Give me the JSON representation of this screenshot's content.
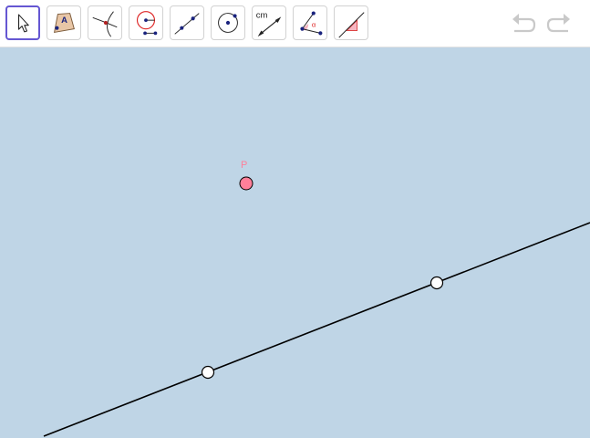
{
  "toolbar": {
    "tools": [
      {
        "icon": "move-arrow-icon",
        "active": true
      },
      {
        "icon": "polygon-icon",
        "label": "A",
        "active": false
      },
      {
        "icon": "intersect-icon",
        "active": false
      },
      {
        "icon": "circle-with-radius-icon",
        "active": false
      },
      {
        "icon": "line-through-points-icon",
        "active": false
      },
      {
        "icon": "circle-with-center-icon",
        "active": false
      },
      {
        "icon": "distance-icon",
        "label": "cm",
        "active": false
      },
      {
        "icon": "angle-icon",
        "label": "α",
        "active": false
      },
      {
        "icon": "slope-icon",
        "active": false
      }
    ],
    "undo_icon": "undo-icon",
    "redo_icon": "redo-icon"
  },
  "graphics": {
    "point_p": {
      "label": "P",
      "color": "#ff7f99"
    },
    "line_color": "#000000",
    "free_point_color": "#ffffff",
    "background": "#bfd5e6"
  }
}
